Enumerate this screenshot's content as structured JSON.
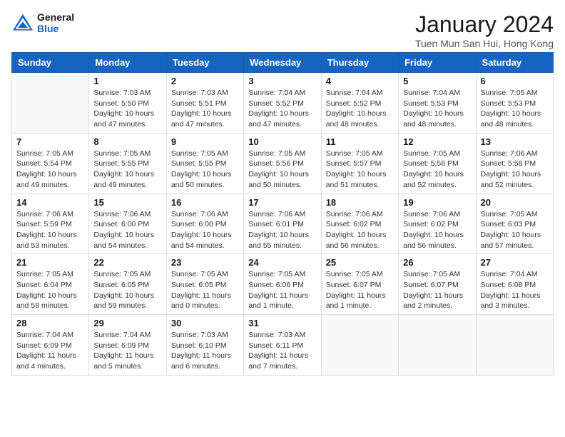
{
  "logo": {
    "line1": "General",
    "line2": "Blue"
  },
  "title": "January 2024",
  "location": "Tuen Mun San Hui, Hong Kong",
  "weekdays": [
    "Sunday",
    "Monday",
    "Tuesday",
    "Wednesday",
    "Thursday",
    "Friday",
    "Saturday"
  ],
  "weeks": [
    [
      {
        "day": null,
        "info": null
      },
      {
        "day": "1",
        "info": "Sunrise: 7:03 AM\nSunset: 5:50 PM\nDaylight: 10 hours\nand 47 minutes."
      },
      {
        "day": "2",
        "info": "Sunrise: 7:03 AM\nSunset: 5:51 PM\nDaylight: 10 hours\nand 47 minutes."
      },
      {
        "day": "3",
        "info": "Sunrise: 7:04 AM\nSunset: 5:52 PM\nDaylight: 10 hours\nand 47 minutes."
      },
      {
        "day": "4",
        "info": "Sunrise: 7:04 AM\nSunset: 5:52 PM\nDaylight: 10 hours\nand 48 minutes."
      },
      {
        "day": "5",
        "info": "Sunrise: 7:04 AM\nSunset: 5:53 PM\nDaylight: 10 hours\nand 48 minutes."
      },
      {
        "day": "6",
        "info": "Sunrise: 7:05 AM\nSunset: 5:53 PM\nDaylight: 10 hours\nand 48 minutes."
      }
    ],
    [
      {
        "day": "7",
        "info": "Sunrise: 7:05 AM\nSunset: 5:54 PM\nDaylight: 10 hours\nand 49 minutes."
      },
      {
        "day": "8",
        "info": "Sunrise: 7:05 AM\nSunset: 5:55 PM\nDaylight: 10 hours\nand 49 minutes."
      },
      {
        "day": "9",
        "info": "Sunrise: 7:05 AM\nSunset: 5:55 PM\nDaylight: 10 hours\nand 50 minutes."
      },
      {
        "day": "10",
        "info": "Sunrise: 7:05 AM\nSunset: 5:56 PM\nDaylight: 10 hours\nand 50 minutes."
      },
      {
        "day": "11",
        "info": "Sunrise: 7:05 AM\nSunset: 5:57 PM\nDaylight: 10 hours\nand 51 minutes."
      },
      {
        "day": "12",
        "info": "Sunrise: 7:05 AM\nSunset: 5:58 PM\nDaylight: 10 hours\nand 52 minutes."
      },
      {
        "day": "13",
        "info": "Sunrise: 7:06 AM\nSunset: 5:58 PM\nDaylight: 10 hours\nand 52 minutes."
      }
    ],
    [
      {
        "day": "14",
        "info": "Sunrise: 7:06 AM\nSunset: 5:59 PM\nDaylight: 10 hours\nand 53 minutes."
      },
      {
        "day": "15",
        "info": "Sunrise: 7:06 AM\nSunset: 6:00 PM\nDaylight: 10 hours\nand 54 minutes."
      },
      {
        "day": "16",
        "info": "Sunrise: 7:06 AM\nSunset: 6:00 PM\nDaylight: 10 hours\nand 54 minutes."
      },
      {
        "day": "17",
        "info": "Sunrise: 7:06 AM\nSunset: 6:01 PM\nDaylight: 10 hours\nand 55 minutes."
      },
      {
        "day": "18",
        "info": "Sunrise: 7:06 AM\nSunset: 6:02 PM\nDaylight: 10 hours\nand 56 minutes."
      },
      {
        "day": "19",
        "info": "Sunrise: 7:06 AM\nSunset: 6:02 PM\nDaylight: 10 hours\nand 56 minutes."
      },
      {
        "day": "20",
        "info": "Sunrise: 7:05 AM\nSunset: 6:03 PM\nDaylight: 10 hours\nand 57 minutes."
      }
    ],
    [
      {
        "day": "21",
        "info": "Sunrise: 7:05 AM\nSunset: 6:04 PM\nDaylight: 10 hours\nand 58 minutes."
      },
      {
        "day": "22",
        "info": "Sunrise: 7:05 AM\nSunset: 6:05 PM\nDaylight: 10 hours\nand 59 minutes."
      },
      {
        "day": "23",
        "info": "Sunrise: 7:05 AM\nSunset: 6:05 PM\nDaylight: 11 hours\nand 0 minutes."
      },
      {
        "day": "24",
        "info": "Sunrise: 7:05 AM\nSunset: 6:06 PM\nDaylight: 11 hours\nand 1 minute."
      },
      {
        "day": "25",
        "info": "Sunrise: 7:05 AM\nSunset: 6:07 PM\nDaylight: 11 hours\nand 1 minute."
      },
      {
        "day": "26",
        "info": "Sunrise: 7:05 AM\nSunset: 6:07 PM\nDaylight: 11 hours\nand 2 minutes."
      },
      {
        "day": "27",
        "info": "Sunrise: 7:04 AM\nSunset: 6:08 PM\nDaylight: 11 hours\nand 3 minutes."
      }
    ],
    [
      {
        "day": "28",
        "info": "Sunrise: 7:04 AM\nSunset: 6:09 PM\nDaylight: 11 hours\nand 4 minutes."
      },
      {
        "day": "29",
        "info": "Sunrise: 7:04 AM\nSunset: 6:09 PM\nDaylight: 11 hours\nand 5 minutes."
      },
      {
        "day": "30",
        "info": "Sunrise: 7:03 AM\nSunset: 6:10 PM\nDaylight: 11 hours\nand 6 minutes."
      },
      {
        "day": "31",
        "info": "Sunrise: 7:03 AM\nSunset: 6:11 PM\nDaylight: 11 hours\nand 7 minutes."
      },
      {
        "day": null,
        "info": null
      },
      {
        "day": null,
        "info": null
      },
      {
        "day": null,
        "info": null
      }
    ]
  ]
}
